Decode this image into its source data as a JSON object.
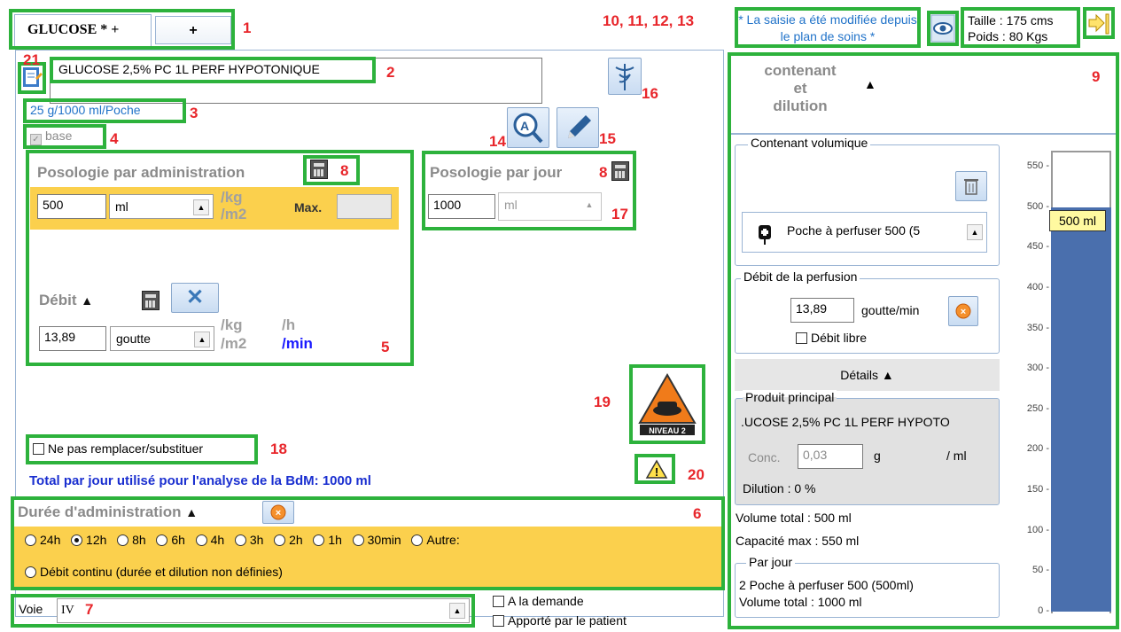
{
  "tabs": [
    {
      "label": "GLUCOSE * +"
    },
    {
      "label": "+"
    }
  ],
  "header": {
    "modified_notice": "* La saisie a été modifiée depuis le plan de soins *",
    "taille": "Taille : 175 cms",
    "poids": "Poids : 80 Kgs"
  },
  "markers": {
    "m1": "1",
    "m2": "2",
    "m3": "3",
    "m4": "4",
    "m5": "5",
    "m6": "6",
    "m7": "7",
    "m8a": "8",
    "m8b": "8",
    "m9": "9",
    "m10": "10, 11, 12, 13",
    "m14": "14",
    "m15": "15",
    "m16": "16",
    "m17": "17",
    "m18": "18",
    "m19": "19",
    "m20": "20",
    "m21": "21"
  },
  "product": {
    "name": "GLUCOSE 2,5% PC 1L PERF HYPOTONIQUE",
    "dosage": "25 g/1000 ml/Poche",
    "base": "base"
  },
  "poso_admin": {
    "title": "Posologie par administration",
    "value": "500",
    "unit": "ml",
    "per_kg": "/kg",
    "per_m2": "/m2",
    "max_label": "Max.",
    "max_value": ""
  },
  "poso_jour": {
    "title": "Posologie par jour",
    "value": "1000",
    "unit": "ml"
  },
  "debit": {
    "title": "Débit",
    "value": "13,89",
    "unit": "goutte",
    "per_kg": "/kg",
    "per_m2": "/m2",
    "per_h": "/h",
    "per_min": "/min"
  },
  "substitution": {
    "label": "Ne pas remplacer/substituer"
  },
  "total_jour": "Total par jour utilisé pour l'analyse de la BdM: 1000 ml",
  "badge": {
    "level": "NIVEAU 2"
  },
  "duree": {
    "title": "Durée d'administration",
    "options": [
      "24h",
      "12h",
      "8h",
      "6h",
      "4h",
      "3h",
      "2h",
      "1h",
      "30min",
      "Autre:"
    ],
    "selected": "12h",
    "continu": "Débit continu (durée et dilution non définies)"
  },
  "voie": {
    "label": "Voie",
    "value": "IV"
  },
  "flags": {
    "a_la_demande": "A la demande",
    "apporte": "Apporté par le patient"
  },
  "right": {
    "section_title": "contenant\net\ndilution",
    "contenant_title": "Contenant volumique",
    "contenant_value": "Poche à perfuser 500 (5",
    "debit_perf_title": "Débit de la perfusion",
    "debit_perf_value": "13,89",
    "debit_perf_unit": "goutte/min",
    "debit_libre": "Débit libre",
    "details": "Détails",
    "produit_title": "Produit principal",
    "produit_name": ".UCOSE 2,5% PC 1L PERF HYPOTO",
    "conc_label": "Conc.",
    "conc_value": "0,03",
    "conc_unit": "g",
    "conc_per": "/ ml",
    "dilution": "Dilution : 0 %",
    "volume_total": "Volume total : 500 ml",
    "capacite": "Capacité max : 550 ml",
    "par_jour_title": "Par jour",
    "par_jour_line1": "2 Poche à perfuser 500 (500ml)",
    "par_jour_line2": "Volume total : 1000 ml"
  },
  "gauge": {
    "ticks": [
      "550",
      "500",
      "450",
      "400",
      "350",
      "300",
      "250",
      "200",
      "150",
      "100",
      "50",
      "0"
    ],
    "max": 550,
    "fill_value": 500,
    "label": "500 ml",
    "fill_color": "#4a6fad"
  }
}
